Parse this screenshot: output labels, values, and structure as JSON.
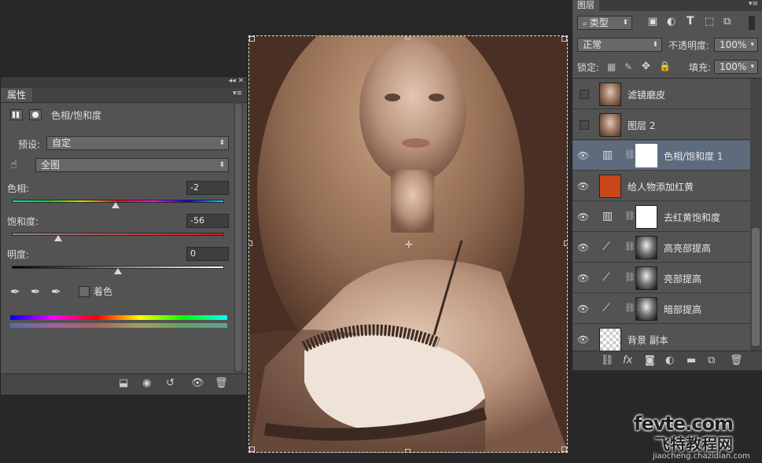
{
  "properties_panel": {
    "tab_label": "属性",
    "adjustment_title": "色相/饱和度",
    "preset_label": "预设:",
    "preset_value": "自定",
    "channel_value": "全图",
    "hue_label": "色相:",
    "hue_value": "-2",
    "hue_level": 0.49,
    "saturation_label": "饱和度:",
    "saturation_value": "-56",
    "saturation_level": 0.22,
    "lightness_label": "明度:",
    "lightness_value": "0",
    "lightness_level": 0.5,
    "colorize_label": "着色",
    "panel_controls": "◂◂ ✕"
  },
  "layers_panel": {
    "tab_label": "图层",
    "filter_kind": "类型",
    "blend_mode": "正常",
    "opacity_label": "不透明度:",
    "opacity_value": "100%",
    "lock_label": "锁定:",
    "fill_label": "填充:",
    "fill_value": "100%",
    "layers": [
      {
        "name": "滤镜磨皮",
        "visible": false,
        "type": "image"
      },
      {
        "name": "图层 2",
        "visible": false,
        "type": "image"
      },
      {
        "name": "色相/饱和度 1",
        "visible": true,
        "type": "adjustment",
        "selected": true
      },
      {
        "name": "给人物添加红黄",
        "visible": true,
        "type": "fill",
        "color": "#c8461a"
      },
      {
        "name": "去红黄饱和度",
        "visible": true,
        "type": "adjustment"
      },
      {
        "name": "高亮部提高",
        "visible": true,
        "type": "curves"
      },
      {
        "name": "亮部提高",
        "visible": true,
        "type": "curves"
      },
      {
        "name": "暗部提高",
        "visible": true,
        "type": "curves"
      },
      {
        "name": "背景 副本",
        "visible": true,
        "type": "transparent"
      }
    ]
  },
  "watermark": {
    "brand": "fevte.com",
    "cn": "飞特教程网",
    "url": "jiaocheng.chazidian.com"
  },
  "colors": {
    "panel_bg": "#535353",
    "app_bg": "#282828",
    "selected_row": "#5e6b7d",
    "fill_layer_color": "#c8461a"
  }
}
